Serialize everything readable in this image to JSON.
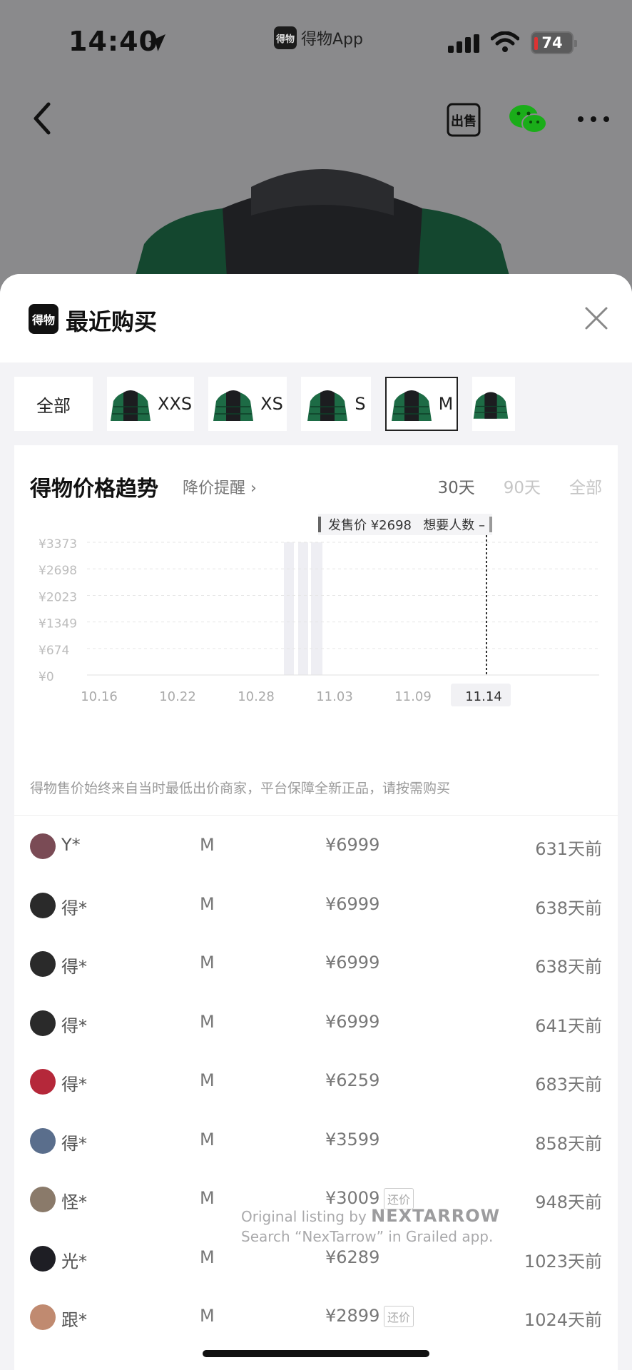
{
  "status_bar": {
    "time": "14:40",
    "app_name": "得物App",
    "app_logo_text": "得物",
    "battery": "74"
  },
  "nav": {
    "back_icon": "back-chevron-icon",
    "sell_icon": "sell-icon",
    "sell_text": "出售",
    "share_icon": "wechat-icon",
    "more_icon": "more-icon"
  },
  "sheet": {
    "logo_text": "得物",
    "title": "最近购买",
    "close_icon": "close-icon"
  },
  "size_tabs": [
    {
      "label": "全部",
      "has_thumb": false,
      "selected": false
    },
    {
      "label": "XXS",
      "has_thumb": true,
      "selected": false
    },
    {
      "label": "XS",
      "has_thumb": true,
      "selected": false
    },
    {
      "label": "S",
      "has_thumb": true,
      "selected": false
    },
    {
      "label": "M",
      "has_thumb": true,
      "selected": true
    },
    {
      "label": "",
      "has_thumb": true,
      "selected": false
    }
  ],
  "trend": {
    "title": "得物价格趋势",
    "remind": "降价提醒",
    "range_tabs": [
      "30天",
      "90天",
      "全部"
    ],
    "active_range": "30天",
    "note": "得物售价始终来自当时最低出价商家，平台保障全新正品，请按需购买"
  },
  "chart_data": {
    "type": "bar",
    "y_ticks": [
      "¥3373",
      "¥2698",
      "¥2023",
      "¥1349",
      "¥674",
      "¥0"
    ],
    "y_tick_values": [
      3373,
      2698,
      2023,
      1349,
      674,
      0
    ],
    "x_ticks": [
      "10.16",
      "10.22",
      "10.28",
      "11.03",
      "11.09",
      "11.14"
    ],
    "selected_x": "11.14",
    "tooltip": {
      "price": "发售价 ¥2698",
      "wanted": "想要人数 –"
    },
    "ylim": [
      0,
      3373
    ],
    "gridlines": true,
    "colors": {
      "bars": "#eeeef3",
      "grid": "#e6e6e6",
      "selected_bg": "#f1f1f4"
    }
  },
  "records": [
    {
      "buyer": "Y*",
      "size": "M",
      "price": "¥6999",
      "ago": "631天前",
      "badge": "",
      "avatar_color": "#7a4b55"
    },
    {
      "buyer": "得*",
      "size": "M",
      "price": "¥6999",
      "ago": "638天前",
      "badge": "",
      "avatar_color": "#2a2a2a"
    },
    {
      "buyer": "得*",
      "size": "M",
      "price": "¥6999",
      "ago": "638天前",
      "badge": "",
      "avatar_color": "#2a2a2a"
    },
    {
      "buyer": "得*",
      "size": "M",
      "price": "¥6999",
      "ago": "641天前",
      "badge": "",
      "avatar_color": "#2a2a2a"
    },
    {
      "buyer": "得*",
      "size": "M",
      "price": "¥6259",
      "ago": "683天前",
      "badge": "",
      "avatar_color": "#b5283a"
    },
    {
      "buyer": "得*",
      "size": "M",
      "price": "¥3599",
      "ago": "858天前",
      "badge": "",
      "avatar_color": "#5a6e8c"
    },
    {
      "buyer": "怪*",
      "size": "M",
      "price": "¥3009",
      "ago": "948天前",
      "badge": "还价",
      "avatar_color": "#8a7a6a"
    },
    {
      "buyer": "光*",
      "size": "M",
      "price": "¥6289",
      "ago": "1023天前",
      "badge": "",
      "avatar_color": "#1e1e24"
    },
    {
      "buyer": "跟*",
      "size": "M",
      "price": "¥2899",
      "ago": "1024天前",
      "badge": "还价",
      "avatar_color": "#c08a70"
    }
  ],
  "watermark": {
    "line1": "Original listing by",
    "brand": "NEXTARROW",
    "line2": "Search “NexTarrow” in Grailed app."
  }
}
